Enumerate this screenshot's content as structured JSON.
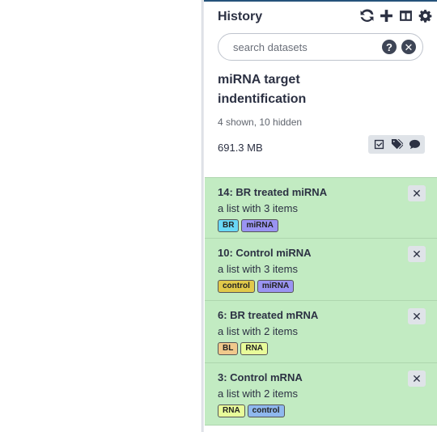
{
  "history": {
    "title": "History",
    "search": {
      "placeholder": "search datasets"
    },
    "name": "miRNA target indentification",
    "counts": "4 shown, 10 hidden",
    "size": "691.3 MB"
  },
  "datasets": [
    {
      "title": "14: BR treated miRNA",
      "subtitle": "a list with 3 items",
      "tags": [
        {
          "label": "BR",
          "color": "#6ad8f6"
        },
        {
          "label": "miRNA",
          "color": "#9a94f2"
        }
      ]
    },
    {
      "title": "10: Control miRNA",
      "subtitle": "a list with 3 items",
      "tags": [
        {
          "label": "control",
          "color": "#e1c94a"
        },
        {
          "label": "miRNA",
          "color": "#9a94f2"
        }
      ]
    },
    {
      "title": "6: BR treated mRNA",
      "subtitle": "a list with 2 items",
      "tags": [
        {
          "label": "BL",
          "color": "#f0c98c"
        },
        {
          "label": "RNA",
          "color": "#e8fb9a"
        }
      ]
    },
    {
      "title": "3: Control mRNA",
      "subtitle": "a list with 2 items",
      "tags": [
        {
          "label": "RNA",
          "color": "#e8fb9a"
        },
        {
          "label": "control",
          "color": "#8fb8ee"
        }
      ]
    }
  ],
  "colors": {
    "header_bar": "#25537b",
    "dataset_ok_bg": "#c2ebc2"
  },
  "icons": [
    "refresh-icon",
    "plus-icon",
    "columns-icon",
    "gear-icon",
    "question-icon",
    "clear-icon",
    "check-square-icon",
    "tags-icon",
    "comment-icon",
    "close-icon"
  ]
}
